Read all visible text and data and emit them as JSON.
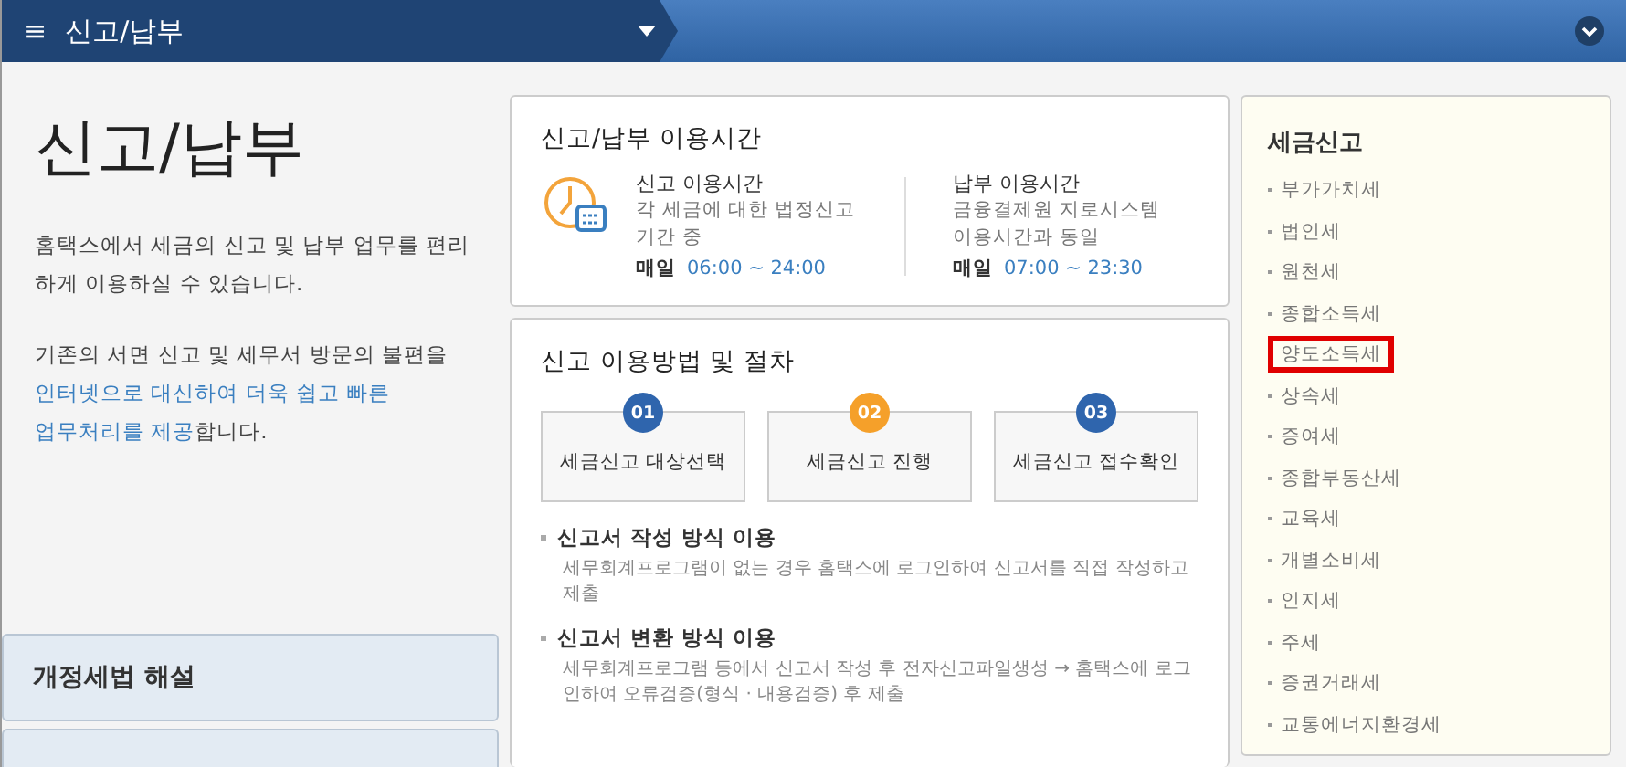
{
  "top_bar": {
    "menu_icon": "≡",
    "title": "신고/납부"
  },
  "intro": {
    "heading": "신고/납부",
    "paragraph": "홈택스에서 세금의 신고 및 납부 업무를 편리하게 이용하실 수 있습니다.",
    "note_plain": "기존의 서면 신고 및 세무서 방문의 불편을 ",
    "note_link_lines": [
      "인터넷으로 대신하여 더욱 쉽고 빠른",
      "업무처리를 제공"
    ],
    "note_end": "합니다."
  },
  "accordion": [
    {
      "label": "개정세법 해설"
    }
  ],
  "hours": {
    "title": "신고/납부 이용시간",
    "columns": [
      {
        "title": "신고 이용시간",
        "lines": [
          "각 세금에 대한 법정신고",
          "기간 중"
        ],
        "day": "매일",
        "time": "06:00 ~ 24:00"
      },
      {
        "title": "납부 이용시간",
        "lines": [
          "금융결제원 지로시스템",
          "이용시간과 동일"
        ],
        "day": "매일",
        "time": "07:00 ~ 23:30"
      }
    ]
  },
  "procedure": {
    "title": "신고 이용방법 및 절차",
    "steps": [
      {
        "number": "01",
        "label": "세금신고 대상선택",
        "color": "#2f65ad"
      },
      {
        "number": "02",
        "label": "세금신고 진행",
        "color": "#f5a02a"
      },
      {
        "number": "03",
        "label": "세금신고 접수확인",
        "color": "#2f65ad"
      }
    ],
    "methods": [
      {
        "title": "신고서 작성 방식 이용",
        "text": "세무회계프로그램이 없는 경우 홈택스에 로그인하여 신고서를 직접 작성하고 제출"
      },
      {
        "title": "신고서 변환 방식 이용",
        "text": "세무회계프로그램 등에서 신고서 작성 후 전자신고파일생성 → 홈택스에 로그인하여 오류검증(형식 · 내용검증) 후 제출"
      }
    ]
  },
  "tax_filing": {
    "title": "세금신고",
    "items": [
      {
        "label": "부가가치세",
        "highlighted": false
      },
      {
        "label": "법인세",
        "highlighted": false
      },
      {
        "label": "원천세",
        "highlighted": false
      },
      {
        "label": "종합소득세",
        "highlighted": false
      },
      {
        "label": "양도소득세",
        "highlighted": true
      },
      {
        "label": "상속세",
        "highlighted": false
      },
      {
        "label": "증여세",
        "highlighted": false
      },
      {
        "label": "종합부동산세",
        "highlighted": false
      },
      {
        "label": "교육세",
        "highlighted": false
      },
      {
        "label": "개별소비세",
        "highlighted": false
      },
      {
        "label": "인지세",
        "highlighted": false
      },
      {
        "label": "주세",
        "highlighted": false
      },
      {
        "label": "증권거래세",
        "highlighted": false
      },
      {
        "label": "교통에너지환경세",
        "highlighted": false
      }
    ]
  }
}
